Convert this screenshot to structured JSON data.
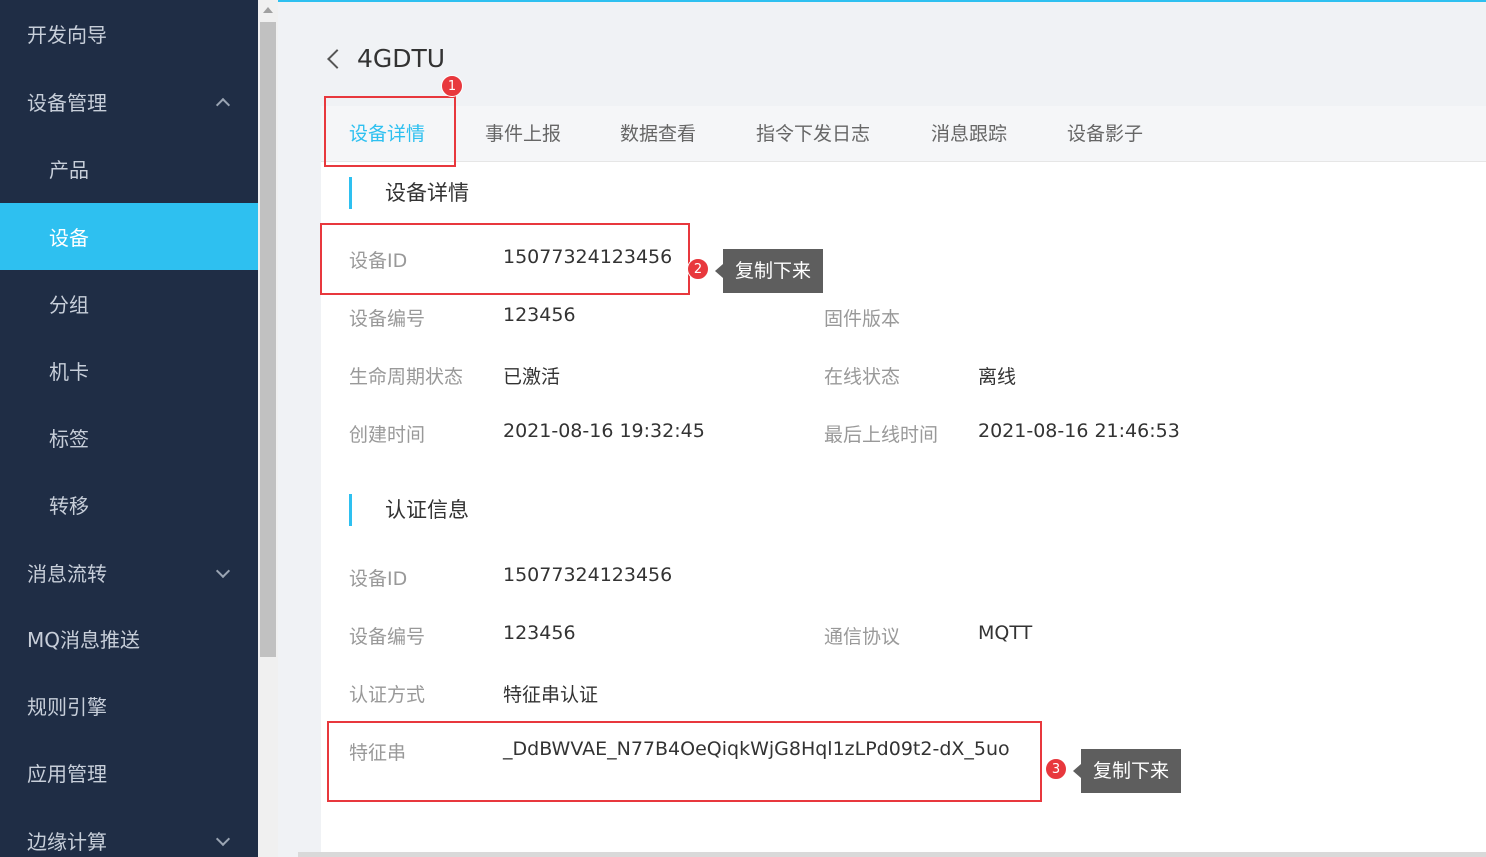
{
  "sidebar": {
    "dev_guide": "开发向导",
    "device_mgmt": "设备管理",
    "product": "产品",
    "device": "设备",
    "group": "分组",
    "sim": "机卡",
    "tag": "标签",
    "transfer": "转移",
    "msg_flow": "消息流转",
    "mq_push": "MQ消息推送",
    "rule_engine": "规则引擎",
    "app_mgmt": "应用管理",
    "edge": "边缘计算"
  },
  "header": {
    "title": "4GDTU"
  },
  "tabs": [
    "设备详情",
    "事件上报",
    "数据查看",
    "指令下发日志",
    "消息跟踪",
    "设备影子"
  ],
  "details": {
    "title": "设备详情",
    "device_id_label": "设备ID",
    "device_id": "15077324123456",
    "device_no_label": "设备编号",
    "device_no": "123456",
    "firmware_label": "固件版本",
    "firmware": "",
    "lifecycle_label": "生命周期状态",
    "lifecycle": "已激活",
    "online_label": "在线状态",
    "online": "离线",
    "created_label": "创建时间",
    "created": "2021-08-16 19:32:45",
    "last_online_label": "最后上线时间",
    "last_online": "2021-08-16 21:46:53"
  },
  "auth": {
    "title": "认证信息",
    "device_id_label": "设备ID",
    "device_id": "15077324123456",
    "device_no_label": "设备编号",
    "device_no": "123456",
    "protocol_label": "通信协议",
    "protocol": "MQTT",
    "auth_method_label": "认证方式",
    "auth_method": "特征串认证",
    "feature_label": "特征串",
    "feature": "_DdBWVAE_N77B4OeQiqkWjG8Hql1zLPd09t2-dX_5uo"
  },
  "annotations": {
    "badge1": "1",
    "badge2": "2",
    "badge3": "3",
    "tip2": "复制下来",
    "tip3": "复制下来"
  },
  "colors": {
    "sidebar_bg": "#1f2d45",
    "accent": "#2ec0f0",
    "annotation_red": "#e8383d"
  }
}
